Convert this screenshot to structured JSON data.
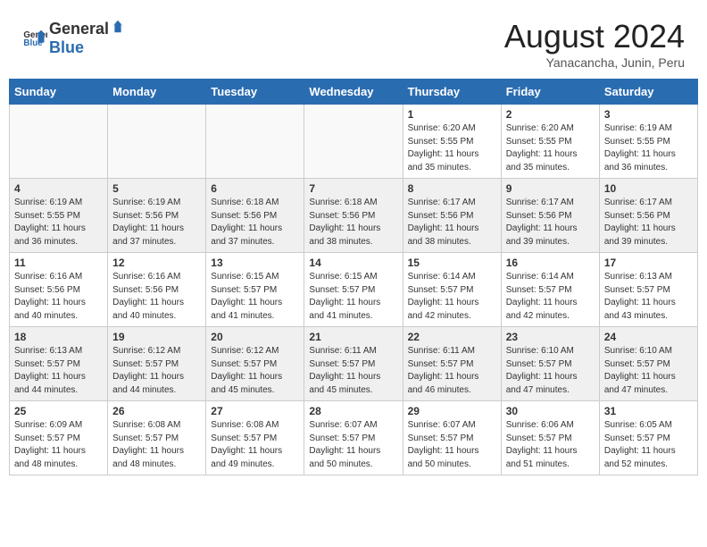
{
  "header": {
    "logo_general": "General",
    "logo_blue": "Blue",
    "month_year": "August 2024",
    "location": "Yanacancha, Junin, Peru"
  },
  "weekdays": [
    "Sunday",
    "Monday",
    "Tuesday",
    "Wednesday",
    "Thursday",
    "Friday",
    "Saturday"
  ],
  "weeks": [
    [
      {
        "day": "",
        "info": ""
      },
      {
        "day": "",
        "info": ""
      },
      {
        "day": "",
        "info": ""
      },
      {
        "day": "",
        "info": ""
      },
      {
        "day": "1",
        "info": "Sunrise: 6:20 AM\nSunset: 5:55 PM\nDaylight: 11 hours\nand 35 minutes."
      },
      {
        "day": "2",
        "info": "Sunrise: 6:20 AM\nSunset: 5:55 PM\nDaylight: 11 hours\nand 35 minutes."
      },
      {
        "day": "3",
        "info": "Sunrise: 6:19 AM\nSunset: 5:55 PM\nDaylight: 11 hours\nand 36 minutes."
      }
    ],
    [
      {
        "day": "4",
        "info": "Sunrise: 6:19 AM\nSunset: 5:55 PM\nDaylight: 11 hours\nand 36 minutes."
      },
      {
        "day": "5",
        "info": "Sunrise: 6:19 AM\nSunset: 5:56 PM\nDaylight: 11 hours\nand 37 minutes."
      },
      {
        "day": "6",
        "info": "Sunrise: 6:18 AM\nSunset: 5:56 PM\nDaylight: 11 hours\nand 37 minutes."
      },
      {
        "day": "7",
        "info": "Sunrise: 6:18 AM\nSunset: 5:56 PM\nDaylight: 11 hours\nand 38 minutes."
      },
      {
        "day": "8",
        "info": "Sunrise: 6:17 AM\nSunset: 5:56 PM\nDaylight: 11 hours\nand 38 minutes."
      },
      {
        "day": "9",
        "info": "Sunrise: 6:17 AM\nSunset: 5:56 PM\nDaylight: 11 hours\nand 39 minutes."
      },
      {
        "day": "10",
        "info": "Sunrise: 6:17 AM\nSunset: 5:56 PM\nDaylight: 11 hours\nand 39 minutes."
      }
    ],
    [
      {
        "day": "11",
        "info": "Sunrise: 6:16 AM\nSunset: 5:56 PM\nDaylight: 11 hours\nand 40 minutes."
      },
      {
        "day": "12",
        "info": "Sunrise: 6:16 AM\nSunset: 5:56 PM\nDaylight: 11 hours\nand 40 minutes."
      },
      {
        "day": "13",
        "info": "Sunrise: 6:15 AM\nSunset: 5:57 PM\nDaylight: 11 hours\nand 41 minutes."
      },
      {
        "day": "14",
        "info": "Sunrise: 6:15 AM\nSunset: 5:57 PM\nDaylight: 11 hours\nand 41 minutes."
      },
      {
        "day": "15",
        "info": "Sunrise: 6:14 AM\nSunset: 5:57 PM\nDaylight: 11 hours\nand 42 minutes."
      },
      {
        "day": "16",
        "info": "Sunrise: 6:14 AM\nSunset: 5:57 PM\nDaylight: 11 hours\nand 42 minutes."
      },
      {
        "day": "17",
        "info": "Sunrise: 6:13 AM\nSunset: 5:57 PM\nDaylight: 11 hours\nand 43 minutes."
      }
    ],
    [
      {
        "day": "18",
        "info": "Sunrise: 6:13 AM\nSunset: 5:57 PM\nDaylight: 11 hours\nand 44 minutes."
      },
      {
        "day": "19",
        "info": "Sunrise: 6:12 AM\nSunset: 5:57 PM\nDaylight: 11 hours\nand 44 minutes."
      },
      {
        "day": "20",
        "info": "Sunrise: 6:12 AM\nSunset: 5:57 PM\nDaylight: 11 hours\nand 45 minutes."
      },
      {
        "day": "21",
        "info": "Sunrise: 6:11 AM\nSunset: 5:57 PM\nDaylight: 11 hours\nand 45 minutes."
      },
      {
        "day": "22",
        "info": "Sunrise: 6:11 AM\nSunset: 5:57 PM\nDaylight: 11 hours\nand 46 minutes."
      },
      {
        "day": "23",
        "info": "Sunrise: 6:10 AM\nSunset: 5:57 PM\nDaylight: 11 hours\nand 47 minutes."
      },
      {
        "day": "24",
        "info": "Sunrise: 6:10 AM\nSunset: 5:57 PM\nDaylight: 11 hours\nand 47 minutes."
      }
    ],
    [
      {
        "day": "25",
        "info": "Sunrise: 6:09 AM\nSunset: 5:57 PM\nDaylight: 11 hours\nand 48 minutes."
      },
      {
        "day": "26",
        "info": "Sunrise: 6:08 AM\nSunset: 5:57 PM\nDaylight: 11 hours\nand 48 minutes."
      },
      {
        "day": "27",
        "info": "Sunrise: 6:08 AM\nSunset: 5:57 PM\nDaylight: 11 hours\nand 49 minutes."
      },
      {
        "day": "28",
        "info": "Sunrise: 6:07 AM\nSunset: 5:57 PM\nDaylight: 11 hours\nand 50 minutes."
      },
      {
        "day": "29",
        "info": "Sunrise: 6:07 AM\nSunset: 5:57 PM\nDaylight: 11 hours\nand 50 minutes."
      },
      {
        "day": "30",
        "info": "Sunrise: 6:06 AM\nSunset: 5:57 PM\nDaylight: 11 hours\nand 51 minutes."
      },
      {
        "day": "31",
        "info": "Sunrise: 6:05 AM\nSunset: 5:57 PM\nDaylight: 11 hours\nand 52 minutes."
      }
    ]
  ]
}
